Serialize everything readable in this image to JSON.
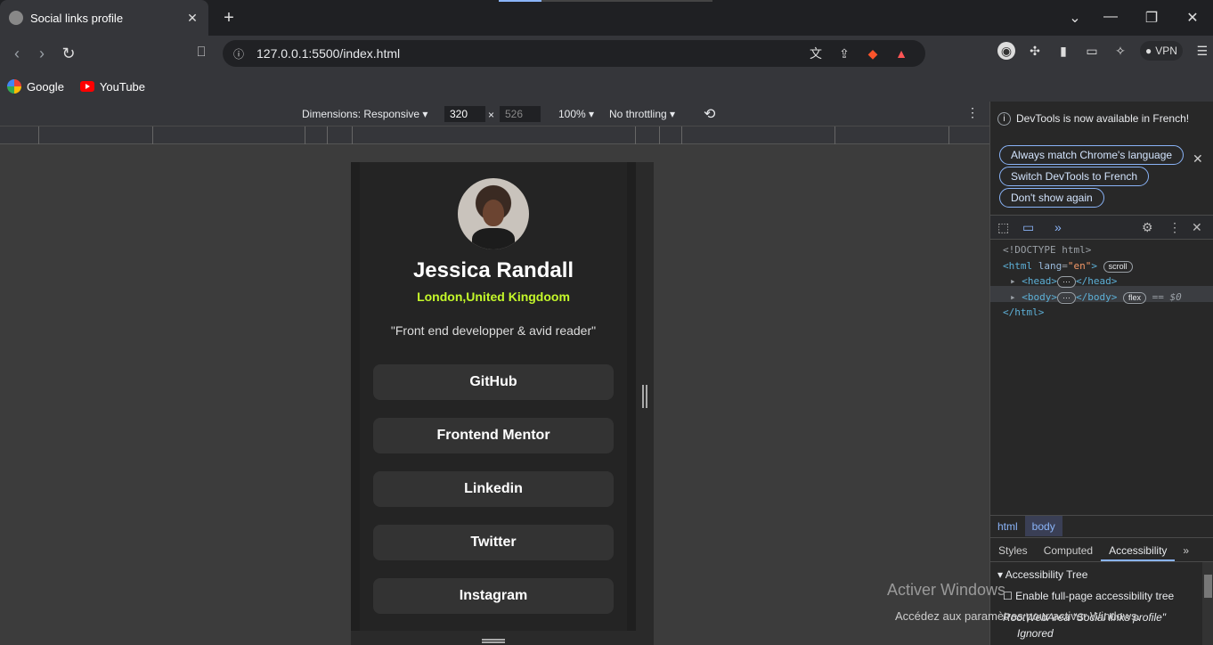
{
  "browser": {
    "tab_title": "Social links profile",
    "tab_close": "✕",
    "new_tab": "+",
    "url": "127.0.0.1:5500/index.html",
    "vpn_label": "VPN",
    "bookmarks": [
      {
        "label": "Google",
        "icon": "google-icon"
      },
      {
        "label": "YouTube",
        "icon": "youtube-icon"
      }
    ]
  },
  "device_toolbar": {
    "dimensions_label": "Dimensions: Responsive ▾",
    "width": "320",
    "times": "×",
    "height": "526",
    "zoom": "100% ▾",
    "throttling": "No throttling ▾"
  },
  "profile": {
    "name": "Jessica Randall",
    "location": "London,United Kingdoom",
    "quote": "\"Front end developper & avid reader\"",
    "links": [
      "GitHub",
      "Frontend Mentor",
      "Linkedin",
      "Twitter",
      "Instagram"
    ],
    "accent_color": "#c4f82a"
  },
  "watermark": {
    "line1": "Activer Windows",
    "line2": "Accédez aux paramètres pour activer Windows."
  },
  "devtools": {
    "notice": "DevTools is now available in French!",
    "buttons": [
      "Always match Chrome's language",
      "Switch DevTools to French",
      "Don't show again"
    ],
    "code": {
      "doctype": "<!DOCTYPE html>",
      "html_open": "<html",
      "lang_attr": "lang",
      "lang_val": "\"en\"",
      "scroll_badge": "scroll",
      "head": "<head>",
      "head_close": "</head>",
      "body": "<body>",
      "body_close": "</body>",
      "flex_badge": "flex",
      "dollar": "== $0",
      "html_close": "</html>"
    },
    "breadcrumbs": [
      "html",
      "body"
    ],
    "panel_tabs": [
      "Styles",
      "Computed",
      "Accessibility"
    ],
    "accessibility": {
      "tree_label": "Accessibility Tree",
      "enable_label": "Enable full-page accessibility tree",
      "root_label": "RootWebArea \"Social links profile\"",
      "ignored": "Ignored"
    }
  }
}
